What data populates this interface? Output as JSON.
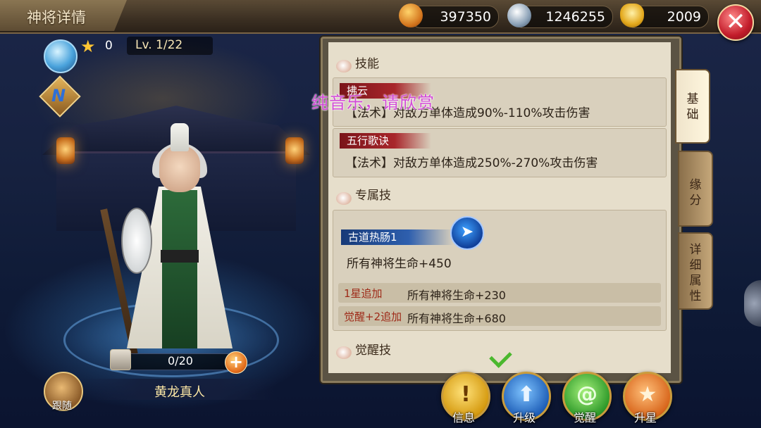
{
  "header": {
    "title": "神将详情",
    "currencies": [
      {
        "icon": "gold-coin-icon",
        "value": "397350",
        "color": "#f2a12a"
      },
      {
        "icon": "silver-coin-icon",
        "value": "1246255",
        "color": "#9db3c8"
      },
      {
        "icon": "gold-ingot-icon",
        "value": "2009",
        "color": "#f2c94c"
      }
    ],
    "close_icon": "close-icon"
  },
  "hero": {
    "stars": "0",
    "level": "Lv. 1/22",
    "rank_letter": "N",
    "fragments": "0/20",
    "name": "黄龙真人",
    "follow_label": "跟随"
  },
  "overlay_text": "纯音乐，请欣赏",
  "panel": {
    "section_skills": "技能",
    "skills": [
      {
        "name": "拂云",
        "desc": "【法术】对敌方单体造成90%-110%攻击伤害"
      },
      {
        "name": "五行歌诀",
        "desc": "【法术】对敌方单体造成250%-270%攻击伤害"
      }
    ],
    "section_exclusive": "专属技",
    "exclusive": {
      "name": "古道热肠1",
      "desc": "所有神将生命+450",
      "bonuses": [
        {
          "label": "1星追加",
          "value": "所有神将生命+230"
        },
        {
          "label": "觉醒+2追加",
          "value": "所有神将生命+680"
        }
      ]
    },
    "section_awaken": "觉醒技"
  },
  "tabs": [
    {
      "label": "基础",
      "active": true
    },
    {
      "label": "缘分",
      "active": false
    },
    {
      "label": "详细属性",
      "active": false
    }
  ],
  "actions": [
    {
      "label": "信息",
      "icon": "exclamation-icon",
      "color": "#f2c12e"
    },
    {
      "label": "升级",
      "icon": "arrow-up-icon",
      "color": "#2f7fd8"
    },
    {
      "label": "觉醒",
      "icon": "swirl-icon",
      "color": "#3aa83a"
    },
    {
      "label": "升星",
      "icon": "star-icon",
      "color": "#e4772a"
    }
  ]
}
